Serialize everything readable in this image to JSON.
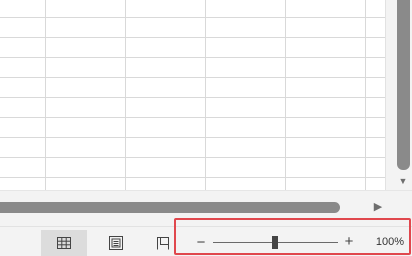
{
  "icons": {
    "vscroll_down": "triangle-down",
    "hscroll_right": "triangle-right",
    "normal_view": "grid-icon",
    "page_layout_view": "page-layout-icon",
    "page_break_view": "page-break-preview-icon"
  },
  "status_bar": {
    "active_view": "normal",
    "zoom": {
      "minus_label": "−",
      "plus_label": "+",
      "level_text": "100%",
      "level": 1.0
    }
  },
  "colors": {
    "highlight": "#e0474d",
    "gridline": "#d9d9d9",
    "scrollbar_thumb": "#8a8a8a"
  }
}
